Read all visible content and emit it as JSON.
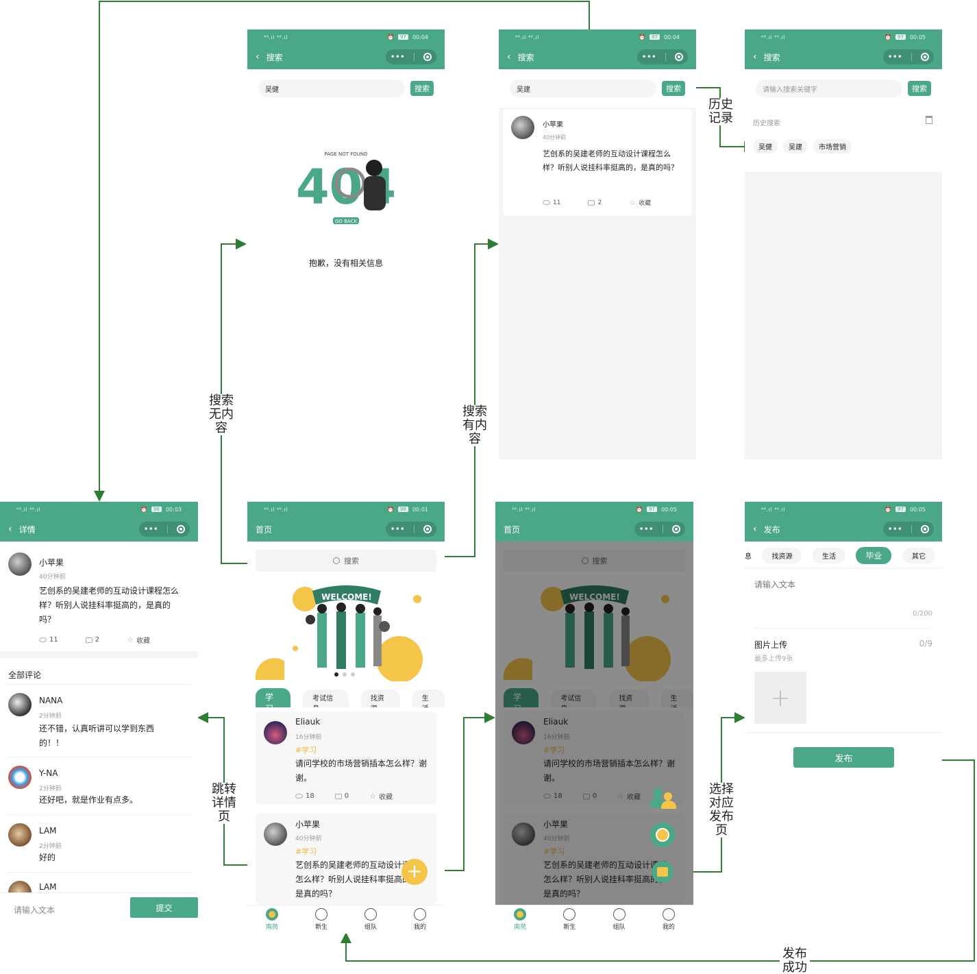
{
  "status": {
    "signal": "⁴⁶.ıl ⁴⁶.ıl",
    "times": [
      "00:04",
      "00:04",
      "00:05",
      "00:03",
      "00:01",
      "00:05",
      "00:05"
    ]
  },
  "search_empty": {
    "title": "搜索",
    "query": "吴健",
    "button": "搜索",
    "not_found_caption": "PAGE NOT FOUND",
    "not_found_code": "404",
    "go_back": "GO BACK",
    "message": "抱歉，没有相关信息"
  },
  "search_result": {
    "title": "搜索",
    "query": "吴建",
    "button": "搜索",
    "post": {
      "user": "小苹果",
      "time": "40分钟前",
      "text": "艺创系的吴建老师的互动设计课程怎么样？听别人说挂科率挺高的，是真的吗？",
      "views": "11",
      "comments": "2",
      "fav": "收藏"
    }
  },
  "search_history": {
    "title": "搜索",
    "placeholder": "请输入搜索关键字",
    "button": "搜索",
    "history_label": "历史搜索",
    "chips": [
      "吴健",
      "吴建",
      "市场营销"
    ]
  },
  "detail": {
    "title": "详情",
    "post": {
      "user": "小苹果",
      "time": "40分钟前",
      "text": "艺创系的吴建老师的互动设计课程怎么样？听别人说挂科率挺高的，是真的吗？",
      "views": "11",
      "comments": "2",
      "fav": "收藏"
    },
    "comments_label": "全部评论",
    "comments": [
      {
        "user": "NANA",
        "time": "2分钟前",
        "text": "还不错，认真听讲可以学到东西的！！"
      },
      {
        "user": "Y-NA",
        "time": "2分钟前",
        "text": "还好吧，就是作业有点多。"
      },
      {
        "user": "LAM",
        "time": "2分钟前",
        "text": "好的"
      },
      {
        "user": "LAM"
      }
    ],
    "input_placeholder": "请输入文本",
    "submit": "提交"
  },
  "home": {
    "title": "首页",
    "search_placeholder": "搜索",
    "banner": "WELCOME!",
    "tabs": [
      "学习",
      "考试信息",
      "找资源",
      "生活"
    ],
    "posts": [
      {
        "user": "Eliauk",
        "time": "16分钟前",
        "tag": "#学习",
        "text": "请问学校的市场营销插本怎么样？谢谢。",
        "views": "18",
        "comments": "0",
        "fav": "收藏"
      },
      {
        "user": "小苹果",
        "time": "40分钟前",
        "tag": "#学习",
        "text": "艺创系的吴建老师的互动设计课程怎么样？听别人说挂科率挺高的，是真的吗？"
      }
    ],
    "bottom": [
      "南苑",
      "新生",
      "组队",
      "我的"
    ]
  },
  "publish": {
    "title": "发布",
    "tabs": [
      "息",
      "找资源",
      "生活",
      "毕业",
      "其它"
    ],
    "text_placeholder": "请输入文本",
    "text_count": "0/200",
    "image_label": "图片上传",
    "image_count": "0/9",
    "image_hint": "最多上传9张",
    "publish_button": "发布"
  },
  "annotations": {
    "history": "历史\n记录",
    "no_content": "搜索\n无内\n容",
    "has_content": "搜索\n有内\n容",
    "to_detail": "跳转\n详情\n页",
    "choose_publish": "选择\n对应\n发布\n页",
    "publish_success": "发布\n成功"
  },
  "colors": {
    "accent": "#4aa887",
    "tag": "#f5b73b",
    "flow": "#2e7d32"
  }
}
